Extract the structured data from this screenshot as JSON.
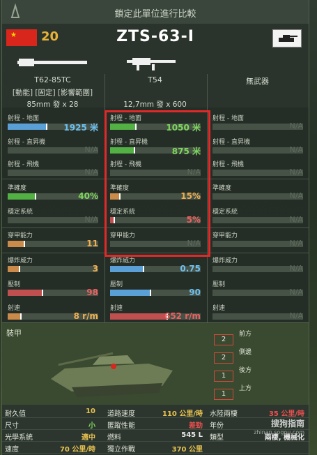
{
  "header": {
    "title": "鎖定此單位進行比較",
    "tier": "20",
    "tank_name": "ZTS-63-I",
    "flag_icon": "china-flag-icon",
    "type_icon": "light-tank-icon"
  },
  "columns": [
    {
      "name": "T62-85TC",
      "sub1": "[動能] [固定] [影響範圍]",
      "sub2": "85mm 發 x 28"
    },
    {
      "name": "T54",
      "sub1": "",
      "sub2": "12,7mm 發 x 600"
    },
    {
      "name": "無武器",
      "sub1": "",
      "sub2": ""
    }
  ],
  "stats": {
    "col1": [
      {
        "label": "射程 - 地面",
        "value": "1925 米",
        "fill": 0.42,
        "color": "#5aa0d6",
        "vcolor": "#6cc0f0"
      },
      {
        "label": "射程 - 直昇機",
        "value": "N/A",
        "fill": 0,
        "color": "#5aa0d6",
        "vcolor": "na"
      },
      {
        "label": "射程 - 飛機",
        "value": "N/A",
        "fill": 0,
        "color": "#5aa0d6",
        "vcolor": "na"
      },
      {
        "label": "準確度",
        "value": "40%",
        "fill": 0.3,
        "color": "#53b044",
        "vcolor": "#7ed85c"
      },
      {
        "label": "穩定系統",
        "value": "N/A",
        "fill": 0,
        "color": "#53b044",
        "vcolor": "na"
      },
      {
        "label": "穿甲能力",
        "value": "11",
        "fill": 0.18,
        "color": "#c98a4a",
        "vcolor": "#f0b050"
      },
      {
        "label": "爆炸威力",
        "value": "3",
        "fill": 0.12,
        "color": "#c98a4a",
        "vcolor": "#f0b050"
      },
      {
        "label": "壓制",
        "value": "98",
        "fill": 0.38,
        "color": "#c05050",
        "vcolor": "#f06060"
      },
      {
        "label": "射速",
        "value": "8 r/m",
        "fill": 0.14,
        "color": "#c98a4a",
        "vcolor": "#f0b050"
      }
    ],
    "col2": [
      {
        "label": "射程 - 地面",
        "value": "1050 米",
        "fill": 0.28,
        "color": "#53b044",
        "vcolor": "#7ed85c"
      },
      {
        "label": "射程 - 直昇機",
        "value": "875 米",
        "fill": 0.26,
        "color": "#53b044",
        "vcolor": "#7ed85c"
      },
      {
        "label": "射程 - 飛機",
        "value": "N/A",
        "fill": 0,
        "color": "#53b044",
        "vcolor": "na"
      },
      {
        "label": "準確度",
        "value": "15%",
        "fill": 0.1,
        "color": "#c98a4a",
        "vcolor": "#f0b050"
      },
      {
        "label": "穩定系統",
        "value": "5%",
        "fill": 0.04,
        "color": "#c05050",
        "vcolor": "#f06060"
      },
      {
        "label": "穿甲能力",
        "value": "N/A",
        "fill": 0,
        "color": "#c98a4a",
        "vcolor": "na"
      },
      {
        "label": "爆炸威力",
        "value": "0.75",
        "fill": 0.36,
        "color": "#5aa0d6",
        "vcolor": "#6cc0f0"
      },
      {
        "label": "壓制",
        "value": "90",
        "fill": 0.44,
        "color": "#5aa0d6",
        "vcolor": "#6cc0f0"
      },
      {
        "label": "射速",
        "value": "652 r/m",
        "fill": 0.62,
        "color": "#c05050",
        "vcolor": "#f06060"
      }
    ],
    "col3": [
      {
        "label": "射程 - 地面",
        "value": "N/A"
      },
      {
        "label": "射程 - 直昇機",
        "value": "N/A"
      },
      {
        "label": "射程 - 飛機",
        "value": "N/A"
      },
      {
        "label": "準確度",
        "value": "N/A"
      },
      {
        "label": "穩定系統",
        "value": "N/A"
      },
      {
        "label": "穿甲能力",
        "value": "N/A"
      },
      {
        "label": "爆炸威力",
        "value": "N/A"
      },
      {
        "label": "壓制",
        "value": "N/A"
      },
      {
        "label": "射速",
        "value": "N/A"
      }
    ]
  },
  "armor": {
    "label": "裝甲",
    "rows": [
      {
        "value": "2",
        "name": "前方"
      },
      {
        "value": "2",
        "name": "側邊"
      },
      {
        "value": "1",
        "name": "後方"
      },
      {
        "value": "1",
        "name": "上方"
      }
    ]
  },
  "bottom": {
    "rows": [
      [
        {
          "k": "耐久值",
          "v": "10",
          "c": "#e8c250"
        },
        {
          "k": "道路速度",
          "v": "110 公里/時",
          "c": "#e8c250"
        },
        {
          "k": "水陸兩棲",
          "v": "35 公里/時",
          "c": "#e85050"
        }
      ],
      [
        {
          "k": "尺寸",
          "v": "小",
          "c": "#7ed85c"
        },
        {
          "k": "匿蹤性能",
          "v": "差勁",
          "c": "#e85050"
        },
        {
          "k": "年份",
          "v": "",
          "c": "#e8c250"
        }
      ],
      [
        {
          "k": "光學系統",
          "v": "適中",
          "c": "#e8c250"
        },
        {
          "k": "燃料",
          "v": "545 L",
          "c": "#e8e8e8"
        },
        {
          "k": "類型",
          "v": "兩棲, 機械化",
          "c": "#e8e8e8"
        }
      ],
      [
        {
          "k": "速度",
          "v": "70 公里/時",
          "c": "#e8c250"
        },
        {
          "k": "獨立作戰",
          "v": "370 公里",
          "c": "#e8c250"
        },
        {
          "k": "",
          "v": "",
          "c": "#e8e8e8"
        }
      ]
    ]
  },
  "watermark": {
    "main": "搜狗指南",
    "sub": "zhinan.sogou.com"
  }
}
